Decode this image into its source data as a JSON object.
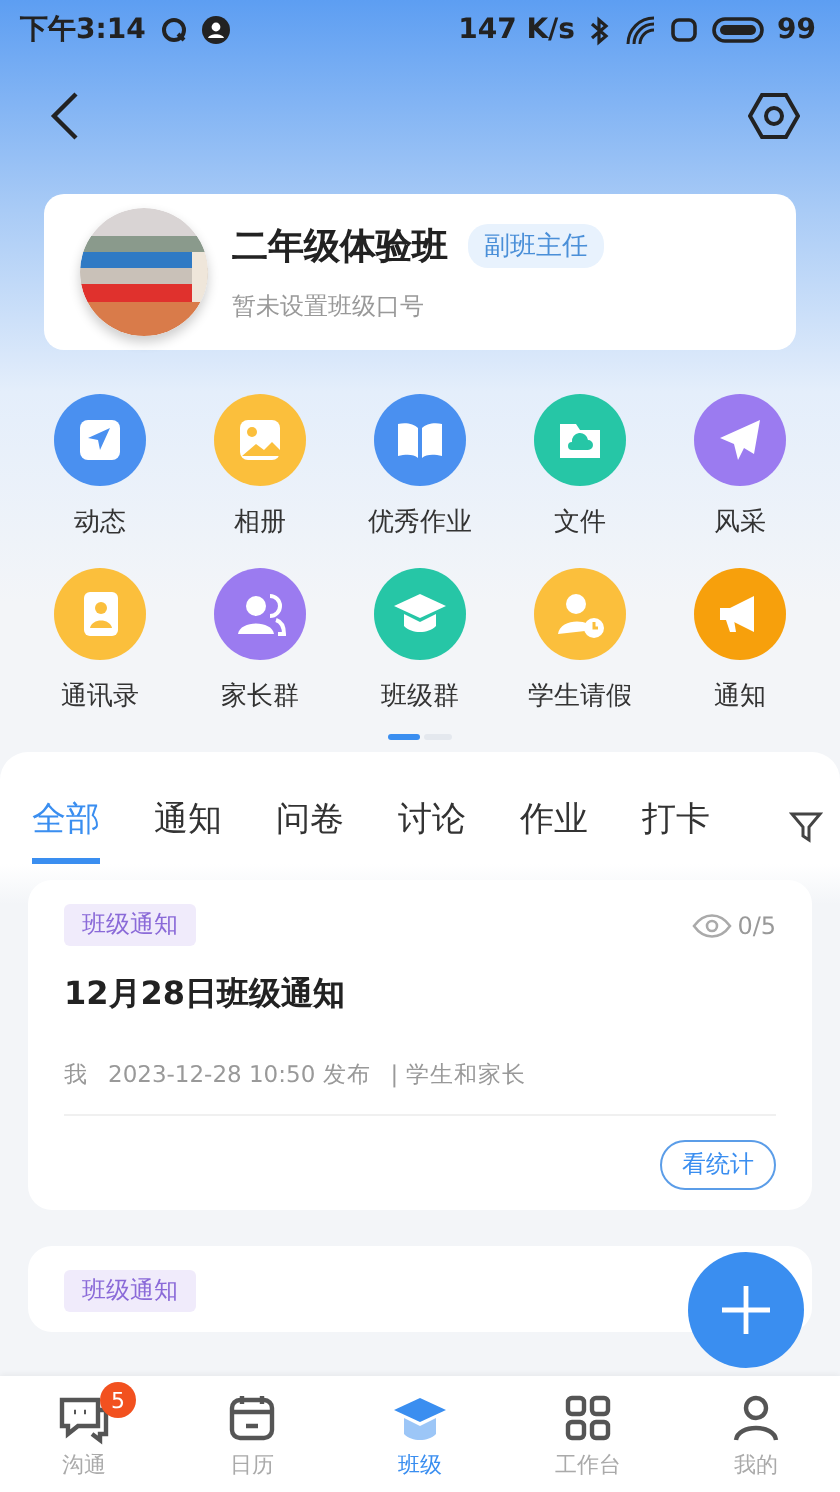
{
  "status_bar": {
    "time": "下午3:14",
    "speed": "147 K/s",
    "battery": "99"
  },
  "class_card": {
    "name": "二年级体验班",
    "role": "副班主任",
    "motto": "暂未设置班级口号"
  },
  "features": [
    {
      "label": "动态",
      "color": "#4a90f0"
    },
    {
      "label": "相册",
      "color": "#fbbf3c"
    },
    {
      "label": "优秀作业",
      "color": "#4a90f0"
    },
    {
      "label": "文件",
      "color": "#26c6a6"
    },
    {
      "label": "风采",
      "color": "#9b7bf0"
    },
    {
      "label": "通讯录",
      "color": "#fbbf3c"
    },
    {
      "label": "家长群",
      "color": "#9b7bf0"
    },
    {
      "label": "班级群",
      "color": "#26c6a6"
    },
    {
      "label": "学生请假",
      "color": "#fbbf3c"
    },
    {
      "label": "通知",
      "color": "#f7a00c"
    }
  ],
  "tabs": [
    {
      "label": "全部",
      "selected": true
    },
    {
      "label": "通知",
      "selected": false
    },
    {
      "label": "问卷",
      "selected": false
    },
    {
      "label": "讨论",
      "selected": false
    },
    {
      "label": "作业",
      "selected": false
    },
    {
      "label": "打卡",
      "selected": false
    }
  ],
  "posts": [
    {
      "tag": "班级通知",
      "views": "0/5",
      "title": "12月28日班级通知",
      "author": "我",
      "time": "2023-12-28 10:50 发布",
      "audience": "| 学生和家长",
      "action": "看统计"
    },
    {
      "tag": "班级通知"
    }
  ],
  "bottom_nav": [
    {
      "label": "沟通",
      "badge": "5",
      "selected": false
    },
    {
      "label": "日历",
      "selected": false
    },
    {
      "label": "班级",
      "selected": true
    },
    {
      "label": "工作台",
      "selected": false
    },
    {
      "label": "我的",
      "selected": false
    }
  ]
}
